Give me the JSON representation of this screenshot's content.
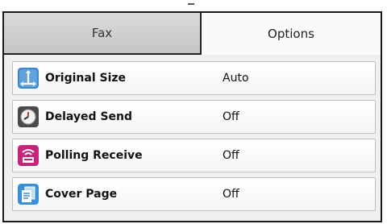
{
  "tabs": [
    {
      "label": "Fax",
      "active": false
    },
    {
      "label": "Options",
      "active": true
    }
  ],
  "options": [
    {
      "label": "Original Size",
      "value": "Auto",
      "icon": "original-size-icon"
    },
    {
      "label": "Delayed Send",
      "value": "Off",
      "icon": "clock-icon"
    },
    {
      "label": "Polling Receive",
      "value": "Off",
      "icon": "polling-receive-icon"
    },
    {
      "label": "Cover Page",
      "value": "Off",
      "icon": "cover-page-icon"
    }
  ],
  "colors": {
    "active_tab": "#fafafa",
    "inactive_tab": "#cfcfcf",
    "original_size_icon": "#3f86c8",
    "delayed_send_icon": "#4a4a4a",
    "polling_receive_icon": "#c2257a",
    "cover_page_icon": "#3b8fd6"
  }
}
